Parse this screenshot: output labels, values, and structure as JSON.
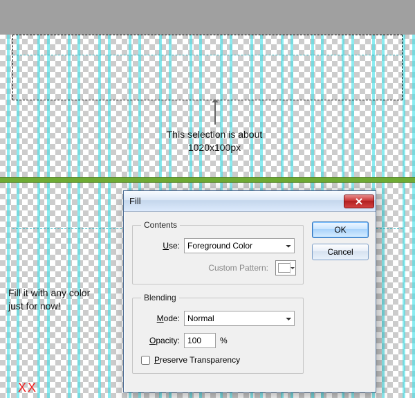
{
  "annotations": {
    "sel_info_line1": "This selection is about",
    "sel_info_line2": "1020x100px",
    "fill_note_line1": "Fill it with any color",
    "fill_note_line2": "just for now!",
    "footer_mark": "XX"
  },
  "dialog": {
    "title": "Fill",
    "contents": {
      "legend": "Contents",
      "use_label": "Use:",
      "use_value": "Foreground Color",
      "custom_pattern_label": "Custom Pattern:"
    },
    "blending": {
      "legend": "Blending",
      "mode_label": "Mode:",
      "mode_value": "Normal",
      "opacity_label": "Opacity:",
      "opacity_value": "100",
      "opacity_unit": "%",
      "preserve_label": "Preserve Transparency",
      "preserve_checked": false
    },
    "buttons": {
      "ok": "OK",
      "cancel": "Cancel"
    }
  }
}
